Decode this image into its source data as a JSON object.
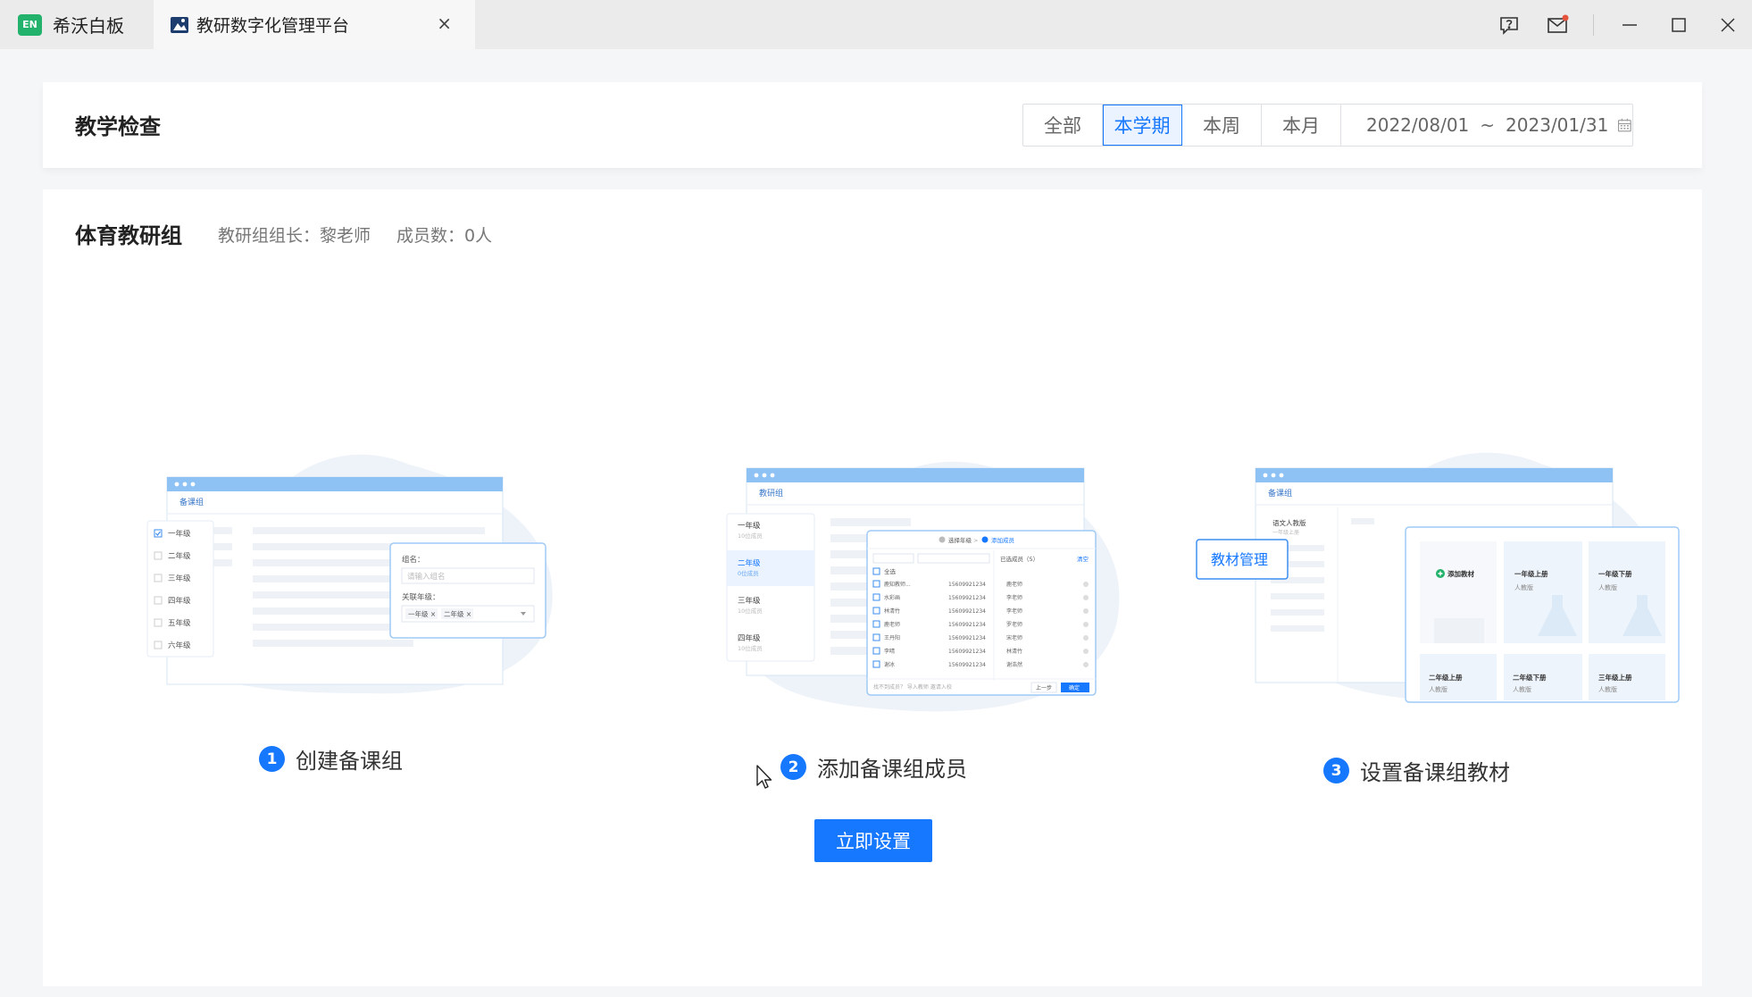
{
  "titlebar": {
    "app_name": "希沃白板",
    "app_logo_text": "EN",
    "tab_title": "教研数字化管理平台",
    "tab_close": "×",
    "icons": [
      "help-icon",
      "mail-icon",
      "minimize-icon",
      "maximize-icon",
      "close-icon"
    ]
  },
  "header": {
    "title": "教学检查",
    "range_tabs": [
      {
        "label": "全部",
        "active": false
      },
      {
        "label": "本学期",
        "active": true
      },
      {
        "label": "本周",
        "active": false
      },
      {
        "label": "本月",
        "active": false
      }
    ],
    "date_start": "2022/08/01",
    "date_sep": "~",
    "date_end": "2023/01/31"
  },
  "group": {
    "name": "体育教研组",
    "leader": "教研组组长：黎老师",
    "members": "成员数：0人"
  },
  "steps": [
    {
      "num": "1",
      "label": "创建备课组"
    },
    {
      "num": "2",
      "label": "添加备课组成员"
    },
    {
      "num": "3",
      "label": "设置备课组教材"
    }
  ],
  "setup_button": "立即设置",
  "illustration1": {
    "window_title": "备课组",
    "grades": [
      "一年级",
      "二年级",
      "三年级",
      "四年级",
      "五年级",
      "六年级"
    ],
    "form_name_label": "组名：",
    "form_name_placeholder": "请输入组名",
    "form_grade_label": "关联年级：",
    "chip1": "一年级 ×",
    "chip2": "二年级 ×"
  },
  "illustration2": {
    "window_title": "教研组",
    "grades": [
      {
        "name": "一年级",
        "sub": "10位成员"
      },
      {
        "name": "二年级",
        "sub": "0位成员"
      },
      {
        "name": "三年级",
        "sub": "10位成员"
      },
      {
        "name": "四年级",
        "sub": "10位成员"
      }
    ],
    "dialog_step1": "选择年级",
    "dialog_step2": "添加成员",
    "dialog_selected": "已选成员（5）",
    "dialog_clear": "清空",
    "dialog_all": "全选",
    "dialog_prev": "上一步",
    "dialog_ok": "确定",
    "dialog_footer": "找不到成员？ 导入教师  邀请入校",
    "members": [
      {
        "name": "鹿知教师...",
        "phone": "15609921234",
        "selected": "鹿老师"
      },
      {
        "name": "水彩画",
        "phone": "15609921234",
        "selected": "李老师"
      },
      {
        "name": "林清竹",
        "phone": "15609921234",
        "selected": "李老师"
      },
      {
        "name": "鹿老师",
        "phone": "15609921234",
        "selected": "罗老师"
      },
      {
        "name": "王丹阳",
        "phone": "15609921234",
        "selected": "宋老师"
      },
      {
        "name": "李晴",
        "phone": "15609921234",
        "selected": "林清竹"
      },
      {
        "name": "谢冰",
        "phone": "15609921234",
        "selected": "谢浩然"
      }
    ]
  },
  "illustration3": {
    "window_title": "备课组",
    "sidebar_item": "语文人教版",
    "sidebar_sub": "一年级上册",
    "badge": "教材管理",
    "add_label": "添加教材",
    "books": [
      {
        "title": "一年级上册",
        "sub": "人教版"
      },
      {
        "title": "一年级下册",
        "sub": "人教版"
      },
      {
        "title": "二年级上册",
        "sub": "人教版"
      },
      {
        "title": "二年级下册",
        "sub": "人教版"
      },
      {
        "title": "三年级上册",
        "sub": "人教版"
      }
    ]
  },
  "colors": {
    "accent": "#1677ff",
    "illus_blue": "#8ec2f5",
    "logo_green": "#23b26b"
  }
}
